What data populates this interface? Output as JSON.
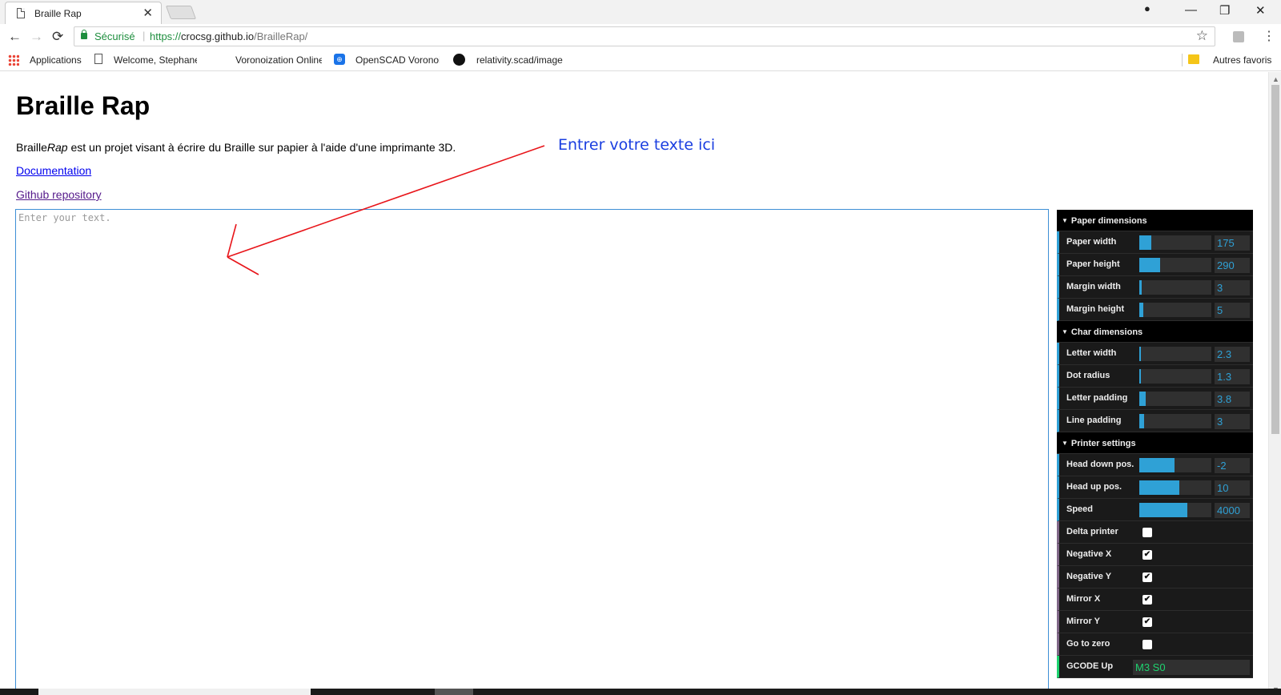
{
  "browser": {
    "tab_title": "Braille Rap",
    "tab_close": "✕",
    "profile_icon": "●",
    "minimize": "—",
    "restore": "❐",
    "close": "✕",
    "back": "←",
    "forward": "→",
    "reload": "⟳",
    "secure_label": "Sécurisé",
    "url_scheme": "https://",
    "url_host": "crocsg.github.io",
    "url_path": "/BrailleRap/",
    "star": "☆",
    "menu": "⋮"
  },
  "bookmarks": {
    "apps": "Applications",
    "items": [
      "Welcome, Stephane!",
      "Voronoization Online",
      "OpenSCAD Voronoi",
      "relativity.scad/image"
    ],
    "other": "Autres favoris"
  },
  "page": {
    "title": "Braille Rap",
    "intro_prefix": "Braille",
    "intro_em": "Rap",
    "intro_suffix": " est un projet visant à écrire du Braille sur papier à l'aide d'une imprimante 3D.",
    "documentation_link": "Documentation",
    "github_link": "Github repository",
    "textarea_placeholder": "Enter your text.",
    "annotation": "Entrer votre texte ici"
  },
  "gui": {
    "sections": [
      {
        "title": "Paper dimensions",
        "controls": [
          {
            "type": "number",
            "label": "Paper width",
            "value": "175",
            "fill": 0.17
          },
          {
            "type": "number",
            "label": "Paper height",
            "value": "290",
            "fill": 0.29
          },
          {
            "type": "number",
            "label": "Margin width",
            "value": "3",
            "fill": 0.03
          },
          {
            "type": "number",
            "label": "Margin height",
            "value": "5",
            "fill": 0.05
          }
        ]
      },
      {
        "title": "Char dimensions",
        "controls": [
          {
            "type": "number",
            "label": "Letter width",
            "value": "2.3",
            "fill": 0.02
          },
          {
            "type": "number",
            "label": "Dot radius",
            "value": "1.3",
            "fill": 0.0
          },
          {
            "type": "number",
            "label": "Letter padding",
            "value": "3.8",
            "fill": 0.09
          },
          {
            "type": "number",
            "label": "Line padding",
            "value": "3",
            "fill": 0.07
          }
        ]
      },
      {
        "title": "Printer settings",
        "controls": [
          {
            "type": "number",
            "label": "Head down pos.",
            "value": "-2",
            "fill": 0.49
          },
          {
            "type": "number",
            "label": "Head up pos.",
            "value": "10",
            "fill": 0.55
          },
          {
            "type": "number",
            "label": "Speed",
            "value": "4000",
            "fill": 0.67
          },
          {
            "type": "boolean",
            "label": "Delta printer",
            "checked": false
          },
          {
            "type": "boolean",
            "label": "Negative X",
            "checked": true
          },
          {
            "type": "boolean",
            "label": "Negative Y",
            "checked": true
          },
          {
            "type": "boolean",
            "label": "Mirror X",
            "checked": true
          },
          {
            "type": "boolean",
            "label": "Mirror Y",
            "checked": true
          },
          {
            "type": "boolean",
            "label": "Go to zero",
            "checked": false
          },
          {
            "type": "string",
            "label": "GCODE Up",
            "value": "M3 S0"
          }
        ]
      }
    ]
  },
  "colors": {
    "gui_number_accent": "#2fa1d6",
    "gui_boolean_accent": "#806787",
    "gui_string_accent": "#1ed36f",
    "annotation": "#1a3ee0",
    "arrow": "#e8151a"
  }
}
